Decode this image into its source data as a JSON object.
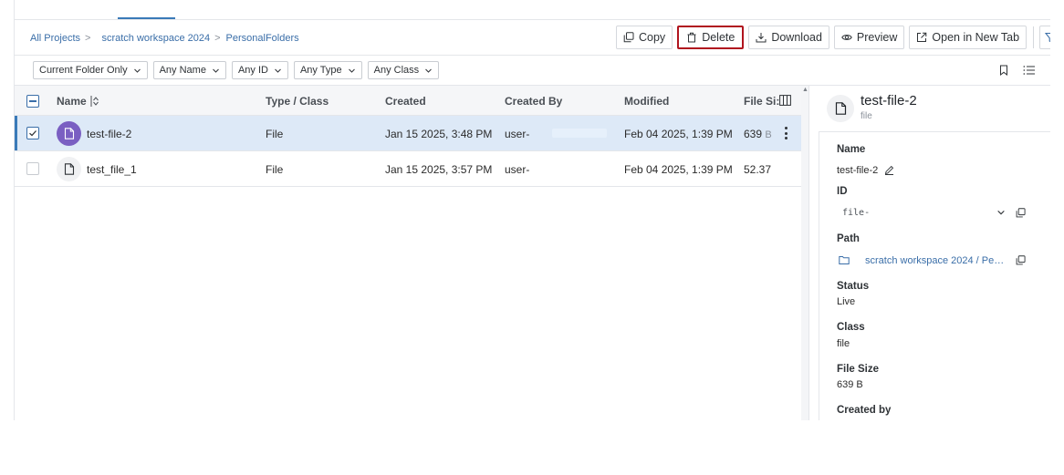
{
  "breadcrumb": {
    "root": "All Projects",
    "sep": ">",
    "project": "scratch workspace 2024",
    "folder": "PersonalFolders"
  },
  "actions": {
    "copy": "Copy",
    "delete": "Delete",
    "download": "Download",
    "preview": "Preview",
    "open_new_tab": "Open in New Tab"
  },
  "filters": [
    "Current Folder Only",
    "Any Name",
    "Any ID",
    "Any Type",
    "Any Class"
  ],
  "table": {
    "headers": {
      "name": "Name",
      "type": "Type / Class",
      "created": "Created",
      "created_by": "Created By",
      "modified": "Modified",
      "size": "File Si:"
    },
    "rows": [
      {
        "name": "test-file-2",
        "type": "File",
        "created": "Jan 15 2025, 3:48 PM",
        "created_by": "user-",
        "modified": "Feb 04 2025, 1:39 PM",
        "size_num": "639",
        "size_unit": "B",
        "selected": true
      },
      {
        "name": "test_file_1",
        "type": "File",
        "created": "Jan 15 2025, 3:57 PM",
        "created_by": "user-",
        "modified": "Feb 04 2025, 1:39 PM",
        "size_num": "52.37",
        "size_unit": "",
        "selected": false
      }
    ]
  },
  "details": {
    "title": "test-file-2",
    "subtitle": "file",
    "name_label": "Name",
    "name_value": "test-file-2",
    "id_label": "ID",
    "id_value": "file-",
    "path_label": "Path",
    "path_value": "scratch workspace 2024 / Pe…",
    "status_label": "Status",
    "status_value": "Live",
    "class_label": "Class",
    "class_value": "file",
    "size_label": "File Size",
    "size_value": "639 B",
    "created_by_label": "Created by"
  },
  "colors": {
    "accent": "#3a7ab8",
    "selected_row": "#dde9f7",
    "delete_outline": "#b0141e",
    "file_avatar": "#7a5fc2"
  }
}
